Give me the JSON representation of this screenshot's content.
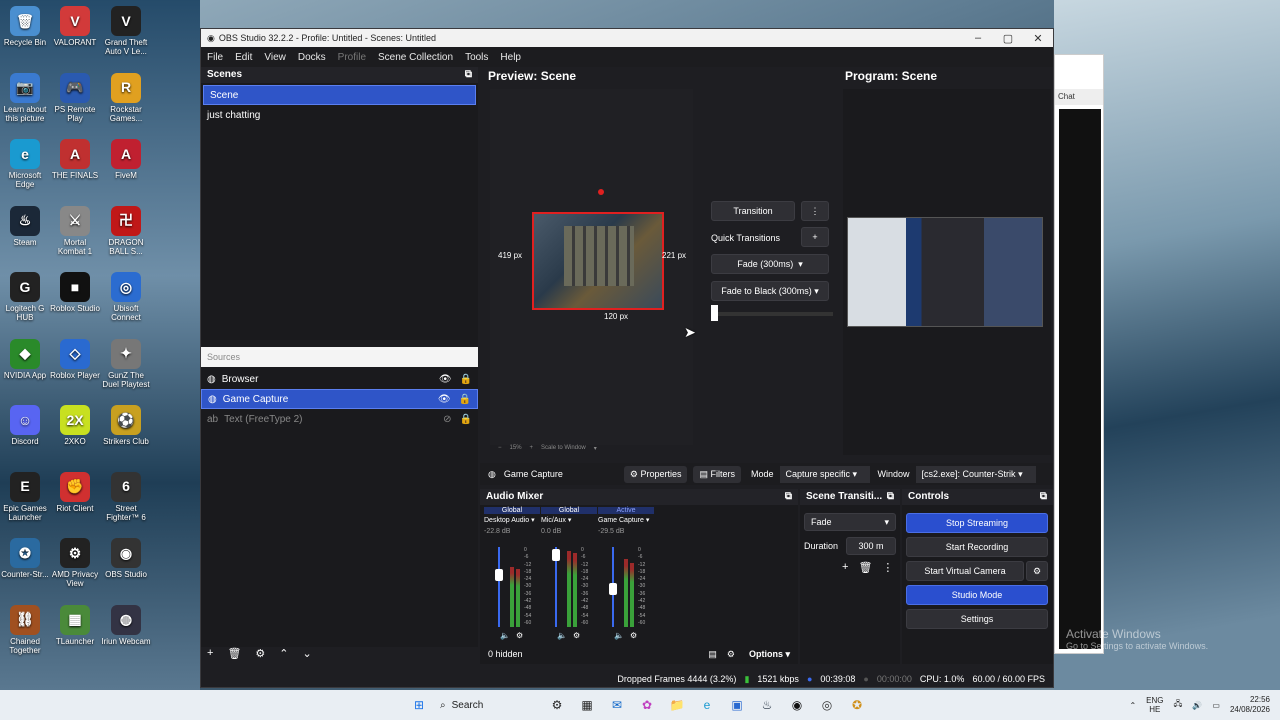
{
  "desktop": {
    "icons": [
      {
        "label": "Recycle Bin",
        "glyph": "🗑"
      },
      {
        "label": "VALORANT",
        "glyph": "V"
      },
      {
        "label": "Grand Theft Auto V Le...",
        "glyph": "V"
      },
      {
        "label": "Learn about this picture",
        "glyph": "📷"
      },
      {
        "label": "PS Remote Play",
        "glyph": "🎮"
      },
      {
        "label": "Rockstar Games...",
        "glyph": "R"
      },
      {
        "label": "Microsoft Edge",
        "glyph": "e"
      },
      {
        "label": "THE FINALS",
        "glyph": "A"
      },
      {
        "label": "FiveM",
        "glyph": "A"
      },
      {
        "label": "Steam",
        "glyph": "♨"
      },
      {
        "label": "Mortal Kombat 1",
        "glyph": "⚔"
      },
      {
        "label": "DRAGON BALL S...",
        "glyph": "卍"
      },
      {
        "label": "Logitech G HUB",
        "glyph": "G"
      },
      {
        "label": "Roblox Studio",
        "glyph": "■"
      },
      {
        "label": "Ubisoft Connect",
        "glyph": "◎"
      },
      {
        "label": "NVIDIA App",
        "glyph": "◆"
      },
      {
        "label": "Roblox Player",
        "glyph": "◇"
      },
      {
        "label": "GunZ The Duel Playtest",
        "glyph": "✦"
      },
      {
        "label": "Discord",
        "glyph": "☺"
      },
      {
        "label": "2XKO",
        "glyph": "2X"
      },
      {
        "label": "Strikers Club",
        "glyph": "⚽"
      },
      {
        "label": "Epic Games Launcher",
        "glyph": "E"
      },
      {
        "label": "Riot Client",
        "glyph": "✊"
      },
      {
        "label": "Street Fighter™ 6",
        "glyph": "6"
      },
      {
        "label": "Counter-Str...",
        "glyph": "✪"
      },
      {
        "label": "AMD Privacy View",
        "glyph": "⚙"
      },
      {
        "label": "OBS Studio",
        "glyph": "◉"
      },
      {
        "label": "Chained Together",
        "glyph": "⛓"
      },
      {
        "label": "TLauncher",
        "glyph": "▦"
      },
      {
        "label": "Iriun Webcam",
        "glyph": "◍"
      }
    ]
  },
  "obs": {
    "title": "OBS Studio 32.2.2 - Profile: Untitled - Scenes: Untitled",
    "menu": [
      "File",
      "Edit",
      "View",
      "Docks",
      "Profile",
      "Scene Collection",
      "Tools",
      "Help"
    ],
    "scenes": {
      "title": "Scenes",
      "items": [
        "Scene",
        "just chatting"
      ]
    },
    "sources": {
      "title": "Sources",
      "items": [
        "Browser",
        "Game Capture",
        "Text (FreeType 2)"
      ]
    },
    "preview": {
      "title": "Preview: Scene",
      "dims": {
        "left": "419 px",
        "right": "221 px",
        "bottom": "120 px"
      },
      "zoom": "15%",
      "scale": "Scale to Window"
    },
    "program": {
      "title": "Program: Scene"
    },
    "transition": {
      "button": "Transition",
      "quick": "Quick Transitions",
      "fade": "Fade (300ms)",
      "fadeblack": "Fade to Black (300ms)"
    },
    "propbar": {
      "source": "Game Capture",
      "properties": "Properties",
      "filters": "Filters",
      "mode_label": "Mode",
      "mode": "Capture specific",
      "window_label": "Window",
      "window": "[cs2.exe]: Counter-Strik"
    },
    "mixer": {
      "title": "Audio Mixer",
      "channels": [
        {
          "tag": "Global",
          "name": "Desktop Audio",
          "db": "-22.8 dB"
        },
        {
          "tag": "Global",
          "name": "Mic/Aux",
          "db": "0.0 dB"
        },
        {
          "tag": "Active",
          "name": "Game Capture",
          "db": "-29.5 dB"
        }
      ],
      "scale": [
        "0",
        "-6",
        "-12",
        "-18",
        "-24",
        "-30",
        "-36",
        "-42",
        "-48",
        "-54",
        "-60"
      ],
      "hidden": "0 hidden",
      "options": "Options"
    },
    "scene_trans": {
      "title": "Scene Transiti...",
      "value": "Fade",
      "duration_label": "Duration",
      "duration": "300 m"
    },
    "controls": {
      "title": "Controls",
      "stop_streaming": "Stop Streaming",
      "start_recording": "Start Recording",
      "start_vcam": "Start Virtual Camera",
      "studio_mode": "Studio Mode",
      "settings": "Settings"
    },
    "status": {
      "dropped": "Dropped Frames 4444 (3.2%)",
      "kbps": "1521 kbps",
      "stream_time": "00:39:08",
      "rec_time": "00:00:00",
      "cpu": "CPU: 1.0%",
      "fps": "60.00 / 60.00 FPS"
    }
  },
  "bgwindow": {
    "chat": "Chat"
  },
  "watermark": {
    "line1": "Activate Windows",
    "line2": "Go to Settings to activate Windows."
  },
  "taskbar": {
    "search": "Search",
    "lang1": "ENG",
    "lang2": "HE",
    "time": "22:56",
    "date": "24/08/2026"
  }
}
